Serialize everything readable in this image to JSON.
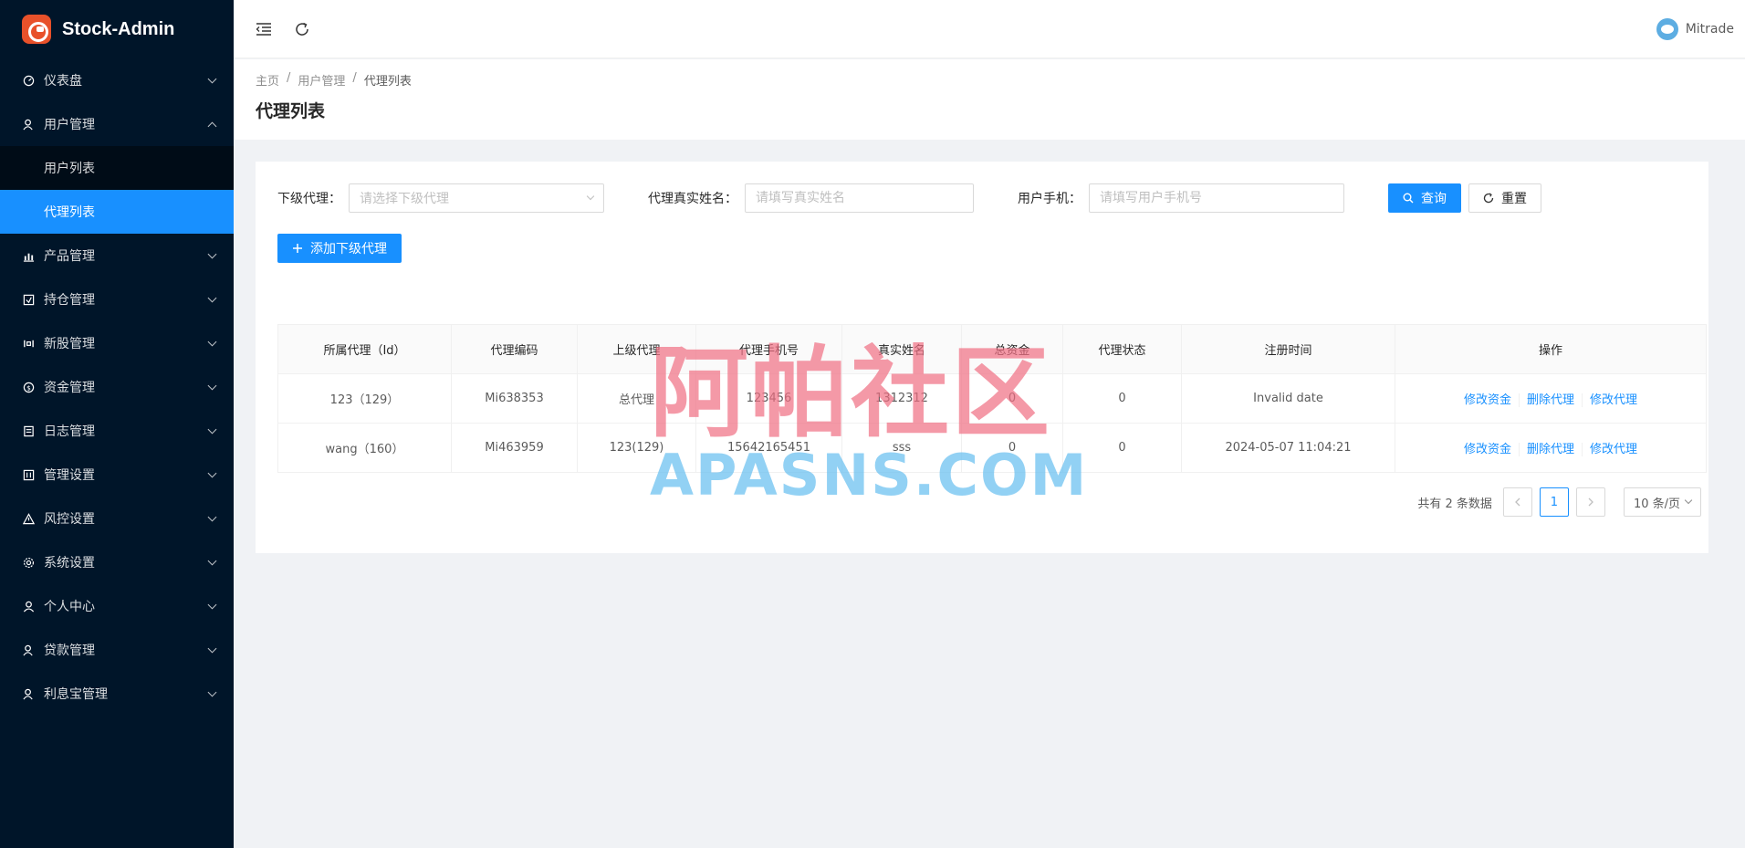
{
  "app": {
    "name": "Stock-Admin"
  },
  "sidebar": {
    "items": [
      {
        "label": "仪表盘",
        "icon": "dashboard-icon"
      },
      {
        "label": "用户管理",
        "icon": "user-manage-icon",
        "expanded": true,
        "children": [
          {
            "label": "用户列表"
          },
          {
            "label": "代理列表",
            "active": true
          }
        ]
      },
      {
        "label": "产品管理",
        "icon": "chart-icon"
      },
      {
        "label": "持仓管理",
        "icon": "position-icon"
      },
      {
        "label": "新股管理",
        "icon": "ipo-icon"
      },
      {
        "label": "资金管理",
        "icon": "money-icon"
      },
      {
        "label": "日志管理",
        "icon": "log-icon"
      },
      {
        "label": "管理设置",
        "icon": "admin-settings-icon"
      },
      {
        "label": "风控设置",
        "icon": "warning-icon"
      },
      {
        "label": "系统设置",
        "icon": "gear-icon"
      },
      {
        "label": "个人中心",
        "icon": "person-icon"
      },
      {
        "label": "贷款管理",
        "icon": "loan-icon"
      },
      {
        "label": "利息宝管理",
        "icon": "interest-icon"
      }
    ]
  },
  "header": {
    "user": "Mitrade"
  },
  "breadcrumb": [
    "主页",
    "用户管理",
    "代理列表"
  ],
  "page": {
    "title": "代理列表"
  },
  "filters": {
    "sub_agent_label": "下级代理：",
    "sub_agent_placeholder": "请选择下级代理",
    "real_name_label": "代理真实姓名：",
    "real_name_placeholder": "请填写真实姓名",
    "phone_label": "用户手机：",
    "phone_placeholder": "请填写用户手机号",
    "search_label": "查询",
    "reset_label": "重置"
  },
  "add_button": "添加下级代理",
  "table": {
    "columns": [
      "所属代理（Id）",
      "代理编码",
      "上级代理",
      "代理手机号",
      "真实姓名",
      "总资金",
      "代理状态",
      "注册时间",
      "操作"
    ],
    "rows": [
      {
        "agent": "123（129）",
        "code": "Mi638353",
        "parent": "总代理",
        "phone": "123456",
        "name": "1312312",
        "funds": "0",
        "status": "0",
        "time": "Invalid date"
      },
      {
        "agent": "wang（160）",
        "code": "Mi463959",
        "parent": "123(129)",
        "phone": "15642165451",
        "name": "sss",
        "funds": "0",
        "status": "0",
        "time": "2024-05-07 11:04:21"
      }
    ],
    "actions": [
      "修改资金",
      "删除代理",
      "修改代理"
    ]
  },
  "pagination": {
    "total": "共有 2 条数据",
    "current": "1",
    "page_size": "10 条/页"
  },
  "watermark": {
    "cn": "阿帕社区",
    "en": "APASNS.COM"
  },
  "colors": {
    "sidebar_bg": "#001529",
    "primary": "#1890ff",
    "submenu_bg": "#000c17"
  }
}
